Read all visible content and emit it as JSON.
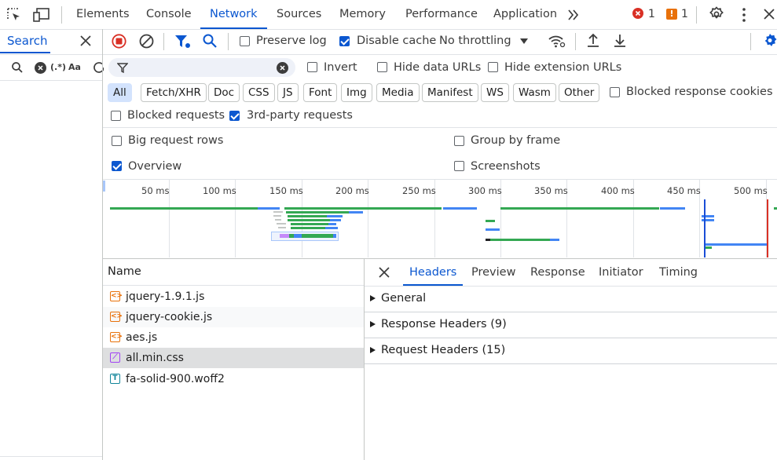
{
  "toolbar": {
    "tabs": [
      "Elements",
      "Console",
      "Network",
      "Sources",
      "Memory",
      "Performance",
      "Application"
    ],
    "error_count": "1",
    "warning_count": "1",
    "warning_glyph": "!"
  },
  "search_panel": {
    "title": "Search",
    "regex_label": "(.*)",
    "case_label": "Aa"
  },
  "network_toolbar": {
    "preserve_log": "Preserve log",
    "disable_cache": "Disable cache",
    "throttling": "No throttling"
  },
  "filter_bar": {
    "invert": "Invert",
    "hide_data_urls": "Hide data URLs",
    "hide_extension_urls": "Hide extension URLs",
    "chips": [
      "All",
      "Fetch/XHR",
      "Doc",
      "CSS",
      "JS",
      "Font",
      "Img",
      "Media",
      "Manifest",
      "WS",
      "Wasm",
      "Other"
    ],
    "blocked_response_cookies": "Blocked response cookies",
    "blocked_requests": "Blocked requests",
    "third_party_requests": "3rd-party requests"
  },
  "settings": {
    "big_request_rows": "Big request rows",
    "group_by_frame": "Group by frame",
    "overview": "Overview",
    "screenshots": "Screenshots"
  },
  "timeline": {
    "ticks": [
      "50 ms",
      "100 ms",
      "150 ms",
      "200 ms",
      "250 ms",
      "300 ms",
      "350 ms",
      "400 ms",
      "450 ms",
      "500 ms"
    ]
  },
  "requests": {
    "column_name": "Name",
    "rows": [
      {
        "name": "jquery-1.9.1.js",
        "type": "script"
      },
      {
        "name": "jquery-cookie.js",
        "type": "script"
      },
      {
        "name": "aes.js",
        "type": "script"
      },
      {
        "name": "all.min.css",
        "type": "stylesheet"
      },
      {
        "name": "fa-solid-900.woff2",
        "type": "font"
      }
    ]
  },
  "details": {
    "tabs": [
      "Headers",
      "Preview",
      "Response",
      "Initiator",
      "Timing"
    ],
    "sections": [
      "General",
      "Response Headers (9)",
      "Request Headers (15)"
    ]
  },
  "colors": {
    "accent": "#0b57d0",
    "record_red": "#d93025",
    "warning_orange": "#e8710a",
    "script_icon": "#e8710a",
    "css_icon": "#a142f4",
    "font_icon": "#12859a",
    "timeline_green": "#34a853",
    "timeline_blue": "#4285f4"
  }
}
